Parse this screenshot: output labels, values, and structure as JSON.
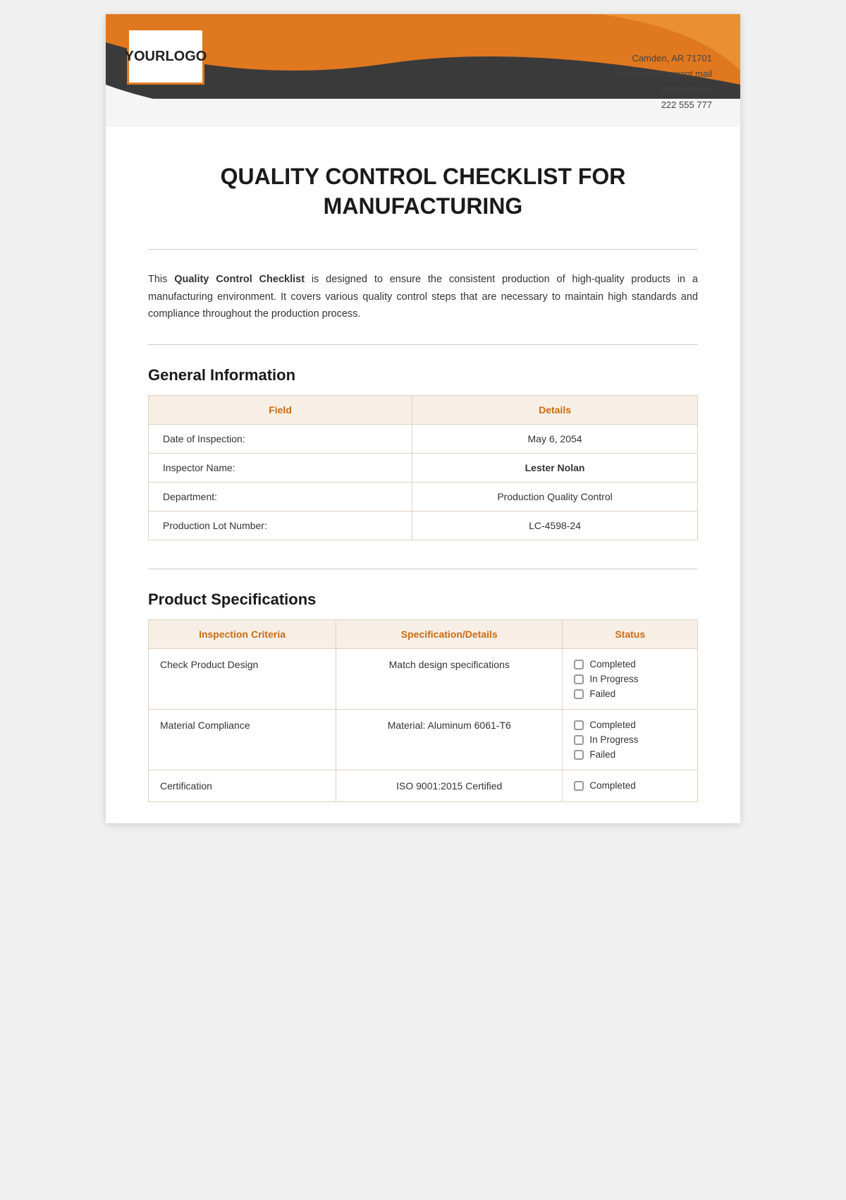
{
  "header": {
    "logo_line1": "YOUR",
    "logo_line2": "LOGO",
    "contact_address": "Camden, AR 71701",
    "contact_email": "inquire@restaurant.mail",
    "contact_website": "template.net",
    "contact_phone": "222 555 777"
  },
  "title": {
    "line1": "QUALITY CONTROL CHECKLIST FOR",
    "line2": "MANUFACTURING"
  },
  "description": {
    "bold_part": "Quality Control Checklist",
    "text": " is designed to ensure the consistent production of high-quality products in a manufacturing environment. It covers various quality control steps that are necessary to maintain high standards and compliance throughout the production process."
  },
  "general_info": {
    "section_title": "General Information",
    "table_headers": [
      "Field",
      "Details"
    ],
    "rows": [
      {
        "field": "Date of Inspection:",
        "detail": "May 6, 2054",
        "bold": false
      },
      {
        "field": "Inspector Name:",
        "detail": "Lester Nolan",
        "bold": true
      },
      {
        "field": "Department:",
        "detail": "Production Quality Control",
        "bold": false
      },
      {
        "field": "Production Lot Number:",
        "detail": "LC-4598-24",
        "bold": false
      }
    ]
  },
  "product_specs": {
    "section_title": "Product Specifications",
    "table_headers": [
      "Inspection Criteria",
      "Specification/Details",
      "Status"
    ],
    "rows": [
      {
        "criteria": "Check Product Design",
        "details": "Match design specifications",
        "statuses": [
          "Completed",
          "In Progress",
          "Failed"
        ]
      },
      {
        "criteria": "Material Compliance",
        "details": "Material: Aluminum 6061-T6",
        "statuses": [
          "Completed",
          "In Progress",
          "Failed"
        ]
      },
      {
        "criteria": "Certification",
        "details": "ISO 9001:2015 Certified",
        "statuses": [
          "Completed"
        ]
      }
    ]
  }
}
